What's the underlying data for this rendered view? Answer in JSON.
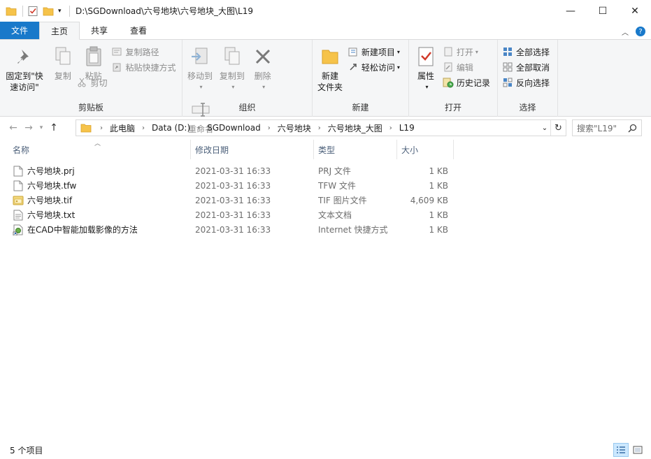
{
  "window": {
    "title": "D:\\SGDownload\\六号地块\\六号地块_大图\\L19",
    "controls": {
      "minimize": "—",
      "maximize": "☐",
      "close": "✕"
    }
  },
  "tabs": [
    {
      "label": "文件"
    },
    {
      "label": "主页"
    },
    {
      "label": "共享"
    },
    {
      "label": "查看"
    }
  ],
  "ribbon": {
    "clipboard": {
      "label": "剪贴板",
      "pin": "固定到\"快速访问\"",
      "pin_line1": "固定到\"快",
      "pin_line2": "速访问\"",
      "copy": "复制",
      "paste": "粘贴",
      "copy_path": "复制路径",
      "paste_shortcut": "粘贴快捷方式",
      "cut": "剪切"
    },
    "organize": {
      "label": "组织",
      "move_to": "移动到",
      "copy_to": "复制到",
      "delete": "删除",
      "rename": "重命名"
    },
    "new": {
      "label": "新建",
      "new_folder_line1": "新建",
      "new_folder_line2": "文件夹",
      "new_item": "新建项目",
      "easy_access": "轻松访问"
    },
    "open": {
      "label": "打开",
      "properties": "属性",
      "open": "打开",
      "edit": "编辑",
      "history": "历史记录"
    },
    "select": {
      "label": "选择",
      "select_all": "全部选择",
      "select_none": "全部取消",
      "invert": "反向选择"
    }
  },
  "address": {
    "crumbs": [
      "此电脑",
      "Data (D:)",
      "SGDownload",
      "六号地块",
      "六号地块_大图",
      "L19"
    ],
    "search_placeholder": "搜索\"L19\""
  },
  "columns": {
    "name": "名称",
    "date": "修改日期",
    "type": "类型",
    "size": "大小"
  },
  "files": [
    {
      "name": "六号地块.prj",
      "date": "2021-03-31 16:33",
      "type": "PRJ 文件",
      "size": "1 KB",
      "icon": "blank-file-icon"
    },
    {
      "name": "六号地块.tfw",
      "date": "2021-03-31 16:33",
      "type": "TFW 文件",
      "size": "1 KB",
      "icon": "blank-file-icon"
    },
    {
      "name": "六号地块.tif",
      "date": "2021-03-31 16:33",
      "type": "TIF 图片文件",
      "size": "4,609 KB",
      "icon": "image-file-icon"
    },
    {
      "name": "六号地块.txt",
      "date": "2021-03-31 16:33",
      "type": "文本文档",
      "size": "1 KB",
      "icon": "text-file-icon"
    },
    {
      "name": "在CAD中智能加载影像的方法",
      "date": "2021-03-31 16:33",
      "type": "Internet 快捷方式",
      "size": "1 KB",
      "icon": "internet-shortcut-icon"
    }
  ],
  "status": {
    "count": "5 个项目"
  },
  "colors": {
    "accent": "#1979ca",
    "header_text": "#4c607a",
    "folder": "#f6c34a"
  }
}
